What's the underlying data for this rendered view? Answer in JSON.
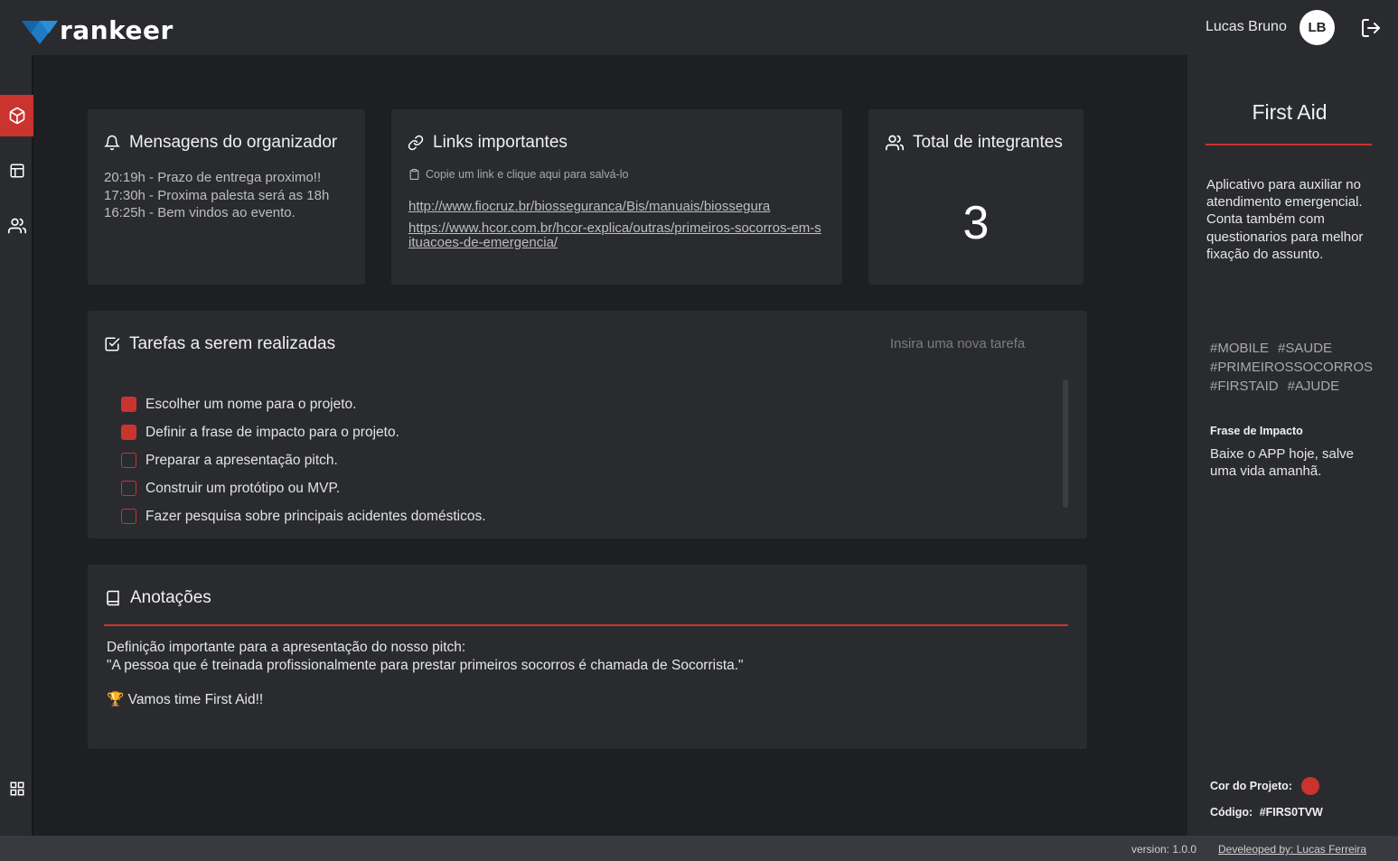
{
  "brand": {
    "name": "rankeer",
    "accent": "#c9342e",
    "logo_mark_color": "#1e7bc4"
  },
  "header": {
    "user_name": "Lucas Bruno",
    "avatar_initials": "LB",
    "logout_icon": "logout-icon"
  },
  "sidebar": {
    "items": [
      {
        "name": "project",
        "icon": "cube-icon",
        "active": true
      },
      {
        "name": "board",
        "icon": "layout-icon",
        "active": false
      },
      {
        "name": "team",
        "icon": "users-icon",
        "active": false
      }
    ],
    "bottom_icon": "grid-icon"
  },
  "messages": {
    "title": "Mensagens do organizador",
    "items": [
      "20:19h - Prazo de entrega proximo!!",
      "17:30h - Proxima palesta será as 18h",
      "16:25h - Bem vindos ao evento."
    ]
  },
  "links": {
    "title": "Links importantes",
    "hint": "Copie um link e clique aqui para salvá-lo",
    "items": [
      "http://www.fiocruz.br/biosseguranca/Bis/manuais/biossegura",
      "https://www.hcor.com.br/hcor-explica/outras/primeiros-socorros-em-situacoes-de-emergencia/"
    ]
  },
  "members": {
    "title": "Total de integrantes",
    "count": "3"
  },
  "tasks": {
    "title": "Tarefas a serem realizadas",
    "input_placeholder": "Insira uma nova tarefa",
    "items": [
      {
        "label": "Escolher um nome para o projeto.",
        "done": true
      },
      {
        "label": "Definir a frase de impacto para o projeto.",
        "done": true
      },
      {
        "label": "Preparar a apresentação pitch.",
        "done": false
      },
      {
        "label": "Construir um protótipo ou MVP.",
        "done": false
      },
      {
        "label": "Fazer pesquisa sobre principais acidentes domésticos.",
        "done": false
      }
    ]
  },
  "notes": {
    "title": "Anotações",
    "line1": "Definição importante para a apresentação do nosso pitch:",
    "line2": "\"A pessoa que é treinada profissionalmente para prestar primeiros socorros é chamada de Socorrista.\"",
    "line3_emoji": "🏆",
    "line3": "Vamos time First Aid!!"
  },
  "project": {
    "title": "First Aid",
    "description": "Aplicativo para auxiliar no atendimento emergencial. Conta também com questionarios para melhor fixação do assunto.",
    "tags": [
      "#MOBILE",
      "#SAUDE",
      "#PRIMEIROSSOCORROS",
      "#FIRSTAID",
      "#AJUDE"
    ],
    "impact_label": "Frase de Impacto",
    "impact_text": "Baixe o APP hoje, salve uma vida amanhã.",
    "color_label": "Cor do Projeto:",
    "color": "#c9342e",
    "code_label": "Código:",
    "code": "#FIRS0TVW"
  },
  "footer": {
    "version": "version: 1.0.0",
    "developer": "Develeoped by: Lucas Ferreira"
  }
}
